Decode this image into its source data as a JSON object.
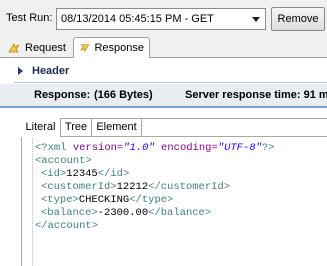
{
  "toolbar": {
    "test_run_label": "Test Run:",
    "test_run_value": "08/13/2014 05:45:15 PM - GET",
    "remove_label": "Remove"
  },
  "tabs": {
    "request": "Request",
    "response": "Response"
  },
  "section": {
    "header_label": "Header",
    "response_label": "Response:",
    "response_size": "(166 Bytes)",
    "server_response_time": "Server response time: 91 m"
  },
  "view_tabs": {
    "literal": "Literal",
    "tree": "Tree",
    "element": "Element"
  },
  "xml": {
    "decl_open": "<?xml ",
    "attr1_name": "version=",
    "attr1_value": "\"1.0\"",
    "attr2_name": " encoding=",
    "attr2_value": "\"UTF-8\"",
    "decl_close": "?>",
    "account_open": "<account>",
    "id_open": "<id>",
    "id_value": "12345",
    "id_close": "</id>",
    "customer_open": "<customerId>",
    "customer_value": "12212",
    "customer_close": "</customerId>",
    "type_open": "<type>",
    "type_value": "CHECKING",
    "type_close": "</type>",
    "balance_open": "<balance>",
    "balance_value": "-2300.00",
    "balance_close": "</balance>",
    "account_close": "</account>"
  },
  "colors": {
    "tag": "#3f7f7f",
    "attr": "#7f007f",
    "value": "#2a00ff",
    "response_bg": "#e9ecf1",
    "accent": "#7aa2cf"
  }
}
